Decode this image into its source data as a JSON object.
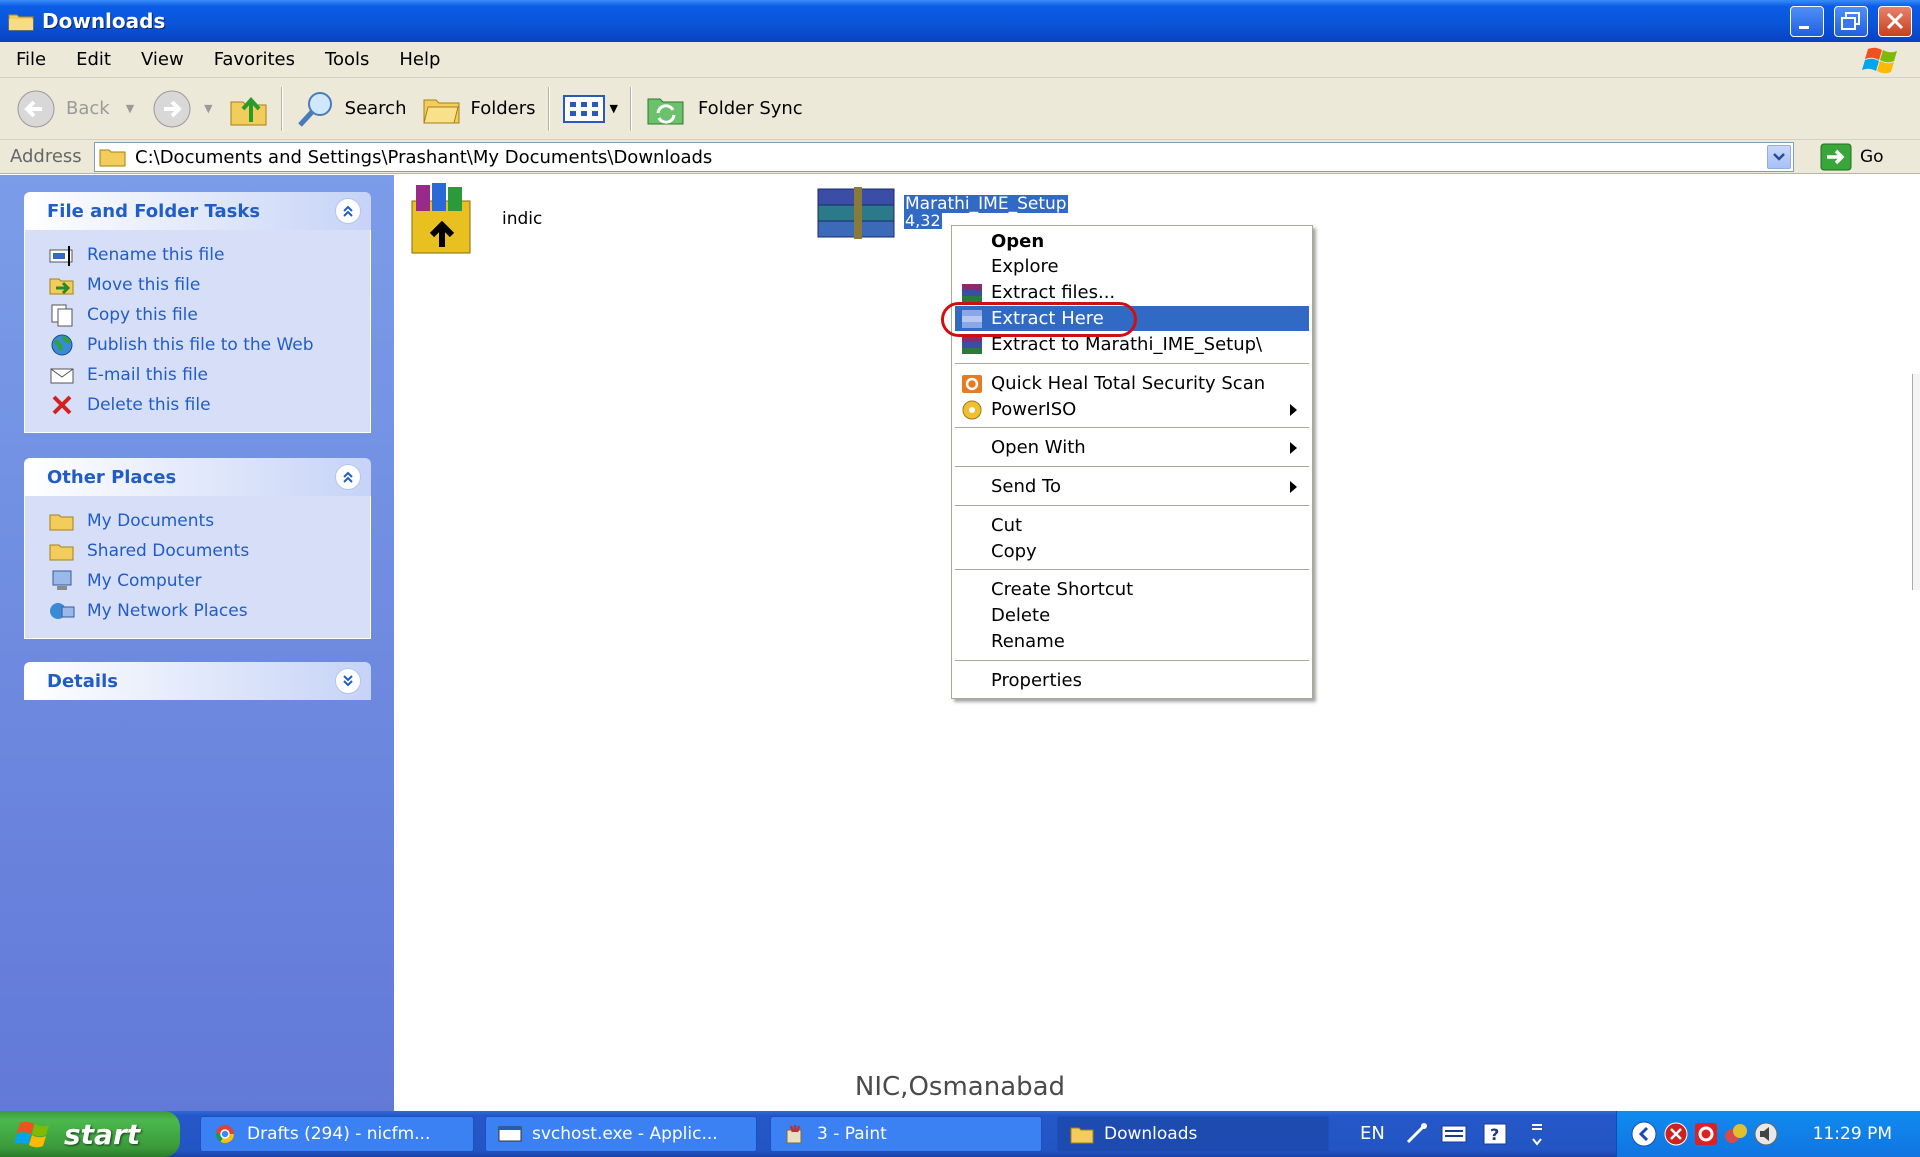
{
  "window": {
    "title": "Downloads"
  },
  "menubar": {
    "items": [
      "File",
      "Edit",
      "View",
      "Favorites",
      "Tools",
      "Help"
    ]
  },
  "toolbar": {
    "back": "Back",
    "search": "Search",
    "folders": "Folders",
    "folder_sync": "Folder Sync"
  },
  "address": {
    "label": "Address",
    "path": "C:\\Documents and Settings\\Prashant\\My Documents\\Downloads",
    "go": "Go"
  },
  "left_panel": {
    "tasks": {
      "title": "File and Folder Tasks",
      "items": [
        "Rename this file",
        "Move this file",
        "Copy this file",
        "Publish this file to the Web",
        "E-mail this file",
        "Delete this file"
      ]
    },
    "places": {
      "title": "Other Places",
      "items": [
        "My Documents",
        "Shared Documents",
        "My Computer",
        "My Network Places"
      ]
    },
    "details": {
      "title": "Details"
    }
  },
  "files": [
    {
      "name": "indic"
    },
    {
      "name": "Marathi_IME_Setup",
      "size": "4,32"
    }
  ],
  "context_menu": {
    "open": "Open",
    "explore": "Explore",
    "extract_files": "Extract files...",
    "extract_here": "Extract Here",
    "extract_to": "Extract to Marathi_IME_Setup\\",
    "quick_heal": "Quick Heal Total Security Scan",
    "poweriso": "PowerISO",
    "open_with": "Open With",
    "send_to": "Send To",
    "cut": "Cut",
    "copy": "Copy",
    "create_shortcut": "Create Shortcut",
    "delete": "Delete",
    "rename": "Rename",
    "properties": "Properties"
  },
  "watermark": "NIC,Osmanabad",
  "taskbar": {
    "start": "start",
    "buttons": [
      "Drafts (294) - nicfm...",
      "svchost.exe - Applic...",
      "3 - Paint",
      "Downloads"
    ],
    "lang": "EN",
    "clock": "11:29 PM"
  },
  "colors": {
    "selection": "#316ac5",
    "title_bar": "#0a54d8",
    "taskbar": "#2457c8",
    "start_green": "#3a9a3a",
    "highlight_oval": "#d01010"
  }
}
